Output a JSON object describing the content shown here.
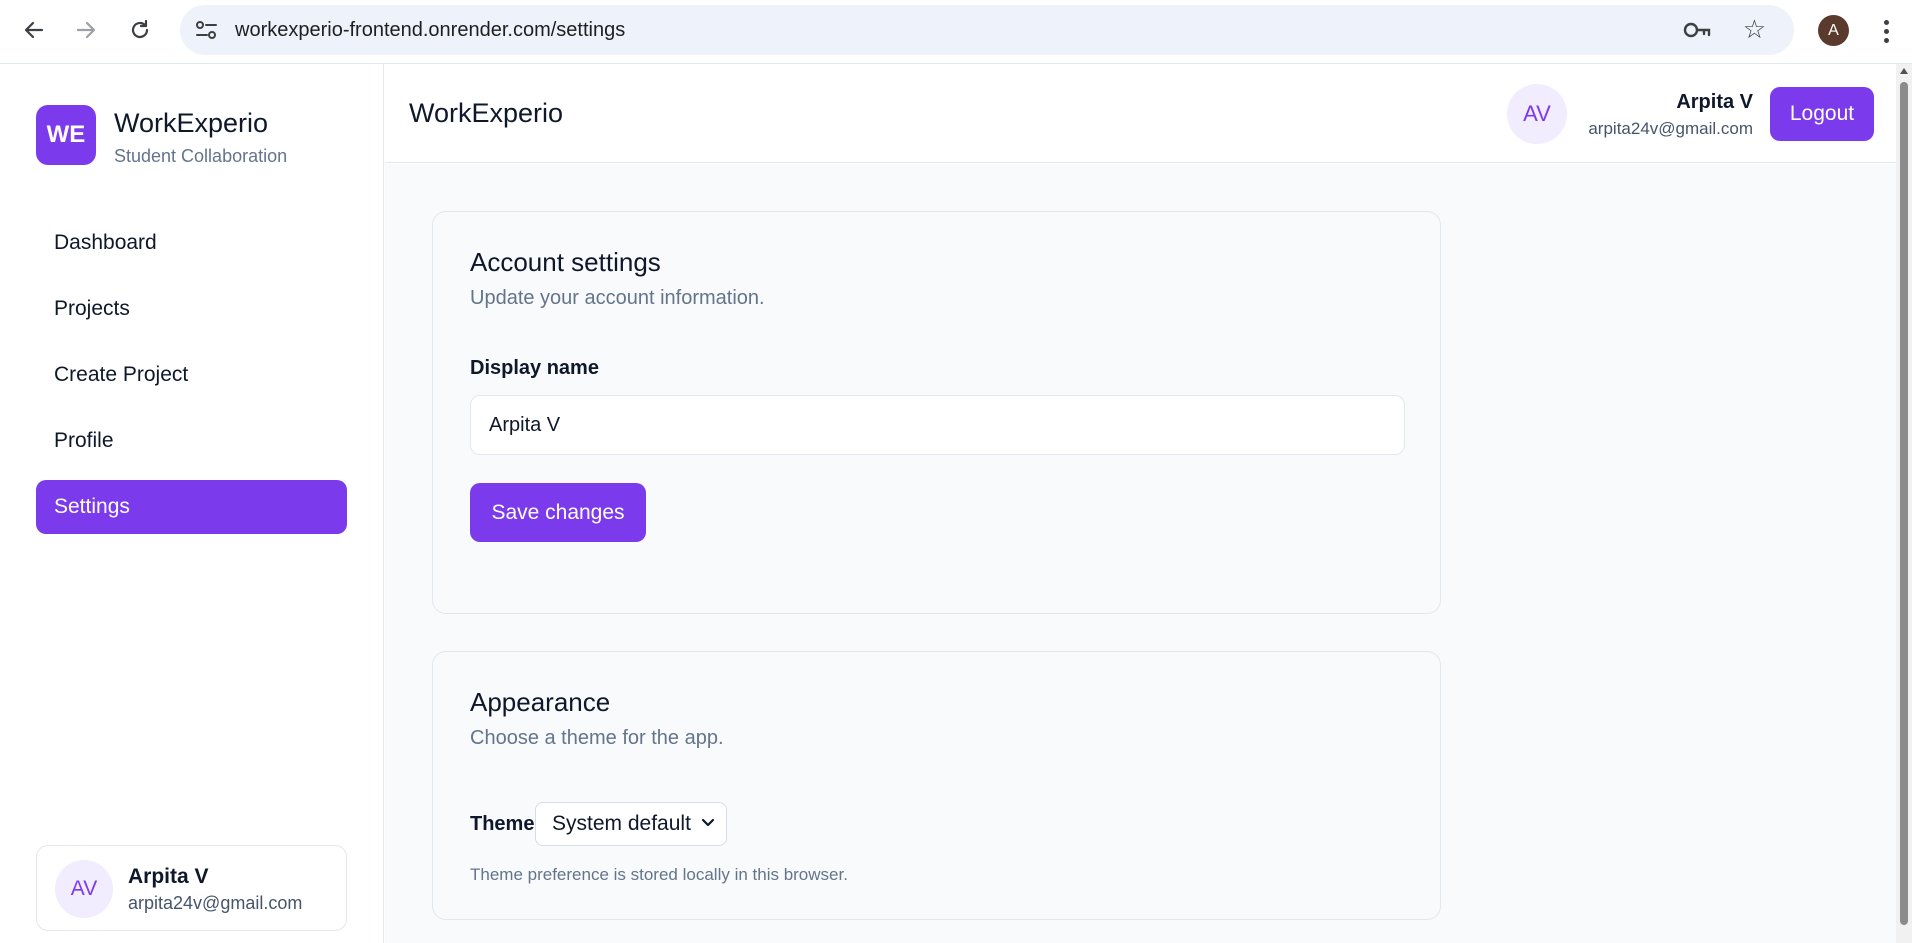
{
  "browser": {
    "url": "workexperio-frontend.onrender.com/settings",
    "profile_initial": "A"
  },
  "sidebar": {
    "logo": "WE",
    "brand": "WorkExperio",
    "tagline": "Student Collaboration",
    "items": [
      {
        "label": "Dashboard",
        "active": false
      },
      {
        "label": "Projects",
        "active": false
      },
      {
        "label": "Create Project",
        "active": false
      },
      {
        "label": "Profile",
        "active": false
      },
      {
        "label": "Settings",
        "active": true
      }
    ],
    "user": {
      "initials": "AV",
      "name": "Arpita V",
      "email": "arpita24v@gmail.com"
    }
  },
  "header": {
    "title": "WorkExperio",
    "avatar": "AV",
    "name": "Arpita V",
    "email": "arpita24v@gmail.com",
    "logout_label": "Logout"
  },
  "account": {
    "title": "Account settings",
    "subtitle": "Update your account information.",
    "display_name_label": "Display name",
    "display_name_value": "Arpita V",
    "save_label": "Save changes"
  },
  "appearance": {
    "title": "Appearance",
    "subtitle": "Choose a theme for the app.",
    "theme_label": "Theme",
    "theme_value": "System default",
    "hint": "Theme preference is stored locally in this browser."
  },
  "colors": {
    "accent": "#7c3aed",
    "avatar_bg": "#f1ecfe",
    "page_bg": "#f8fafc"
  }
}
